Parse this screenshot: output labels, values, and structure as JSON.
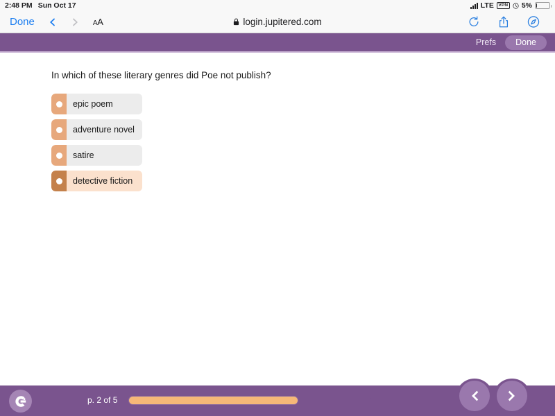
{
  "status_bar": {
    "time": "2:48 PM",
    "date": "Sun Oct 17",
    "carrier": "LTE",
    "vpn_badge": "VPN",
    "battery_percent": "5%",
    "signal_icon": "signal-bars-icon",
    "alarm_icon": "alarm-clock-icon",
    "battery_icon": "battery-icon"
  },
  "browser": {
    "done_label": "Done",
    "back_icon": "chevron-left-icon",
    "forward_icon": "chevron-right-icon",
    "text_size_label_big": "A",
    "text_size_label_small": "A",
    "lock_icon": "lock-icon",
    "url": "login.jupitered.com",
    "reload_icon": "reload-icon",
    "share_icon": "share-icon",
    "compass_icon": "safari-compass-icon"
  },
  "app_header": {
    "prefs_label": "Prefs",
    "done_label": "Done",
    "background_color": "#7a548e",
    "done_pill_color": "#9a78ad"
  },
  "quiz": {
    "question": "In which of these literary genres did Poe not publish?",
    "choices": [
      {
        "label": "epic poem",
        "selected": false
      },
      {
        "label": "adventure novel",
        "selected": false
      },
      {
        "label": "satire",
        "selected": false
      },
      {
        "label": "detective fiction",
        "selected": true
      }
    ],
    "colors": {
      "tab_unselected": "#e7a87c",
      "tab_selected": "#c4814b",
      "body_unselected": "#ececec",
      "body_selected": "#fbe1cd"
    }
  },
  "footer": {
    "logo_icon": "jupiter-ed-logo-icon",
    "page_label": "p. 2 of 5",
    "progress_percent": 70,
    "progress_color": "#f6b878",
    "prev_icon": "chevron-left-icon",
    "next_icon": "chevron-right-icon"
  }
}
